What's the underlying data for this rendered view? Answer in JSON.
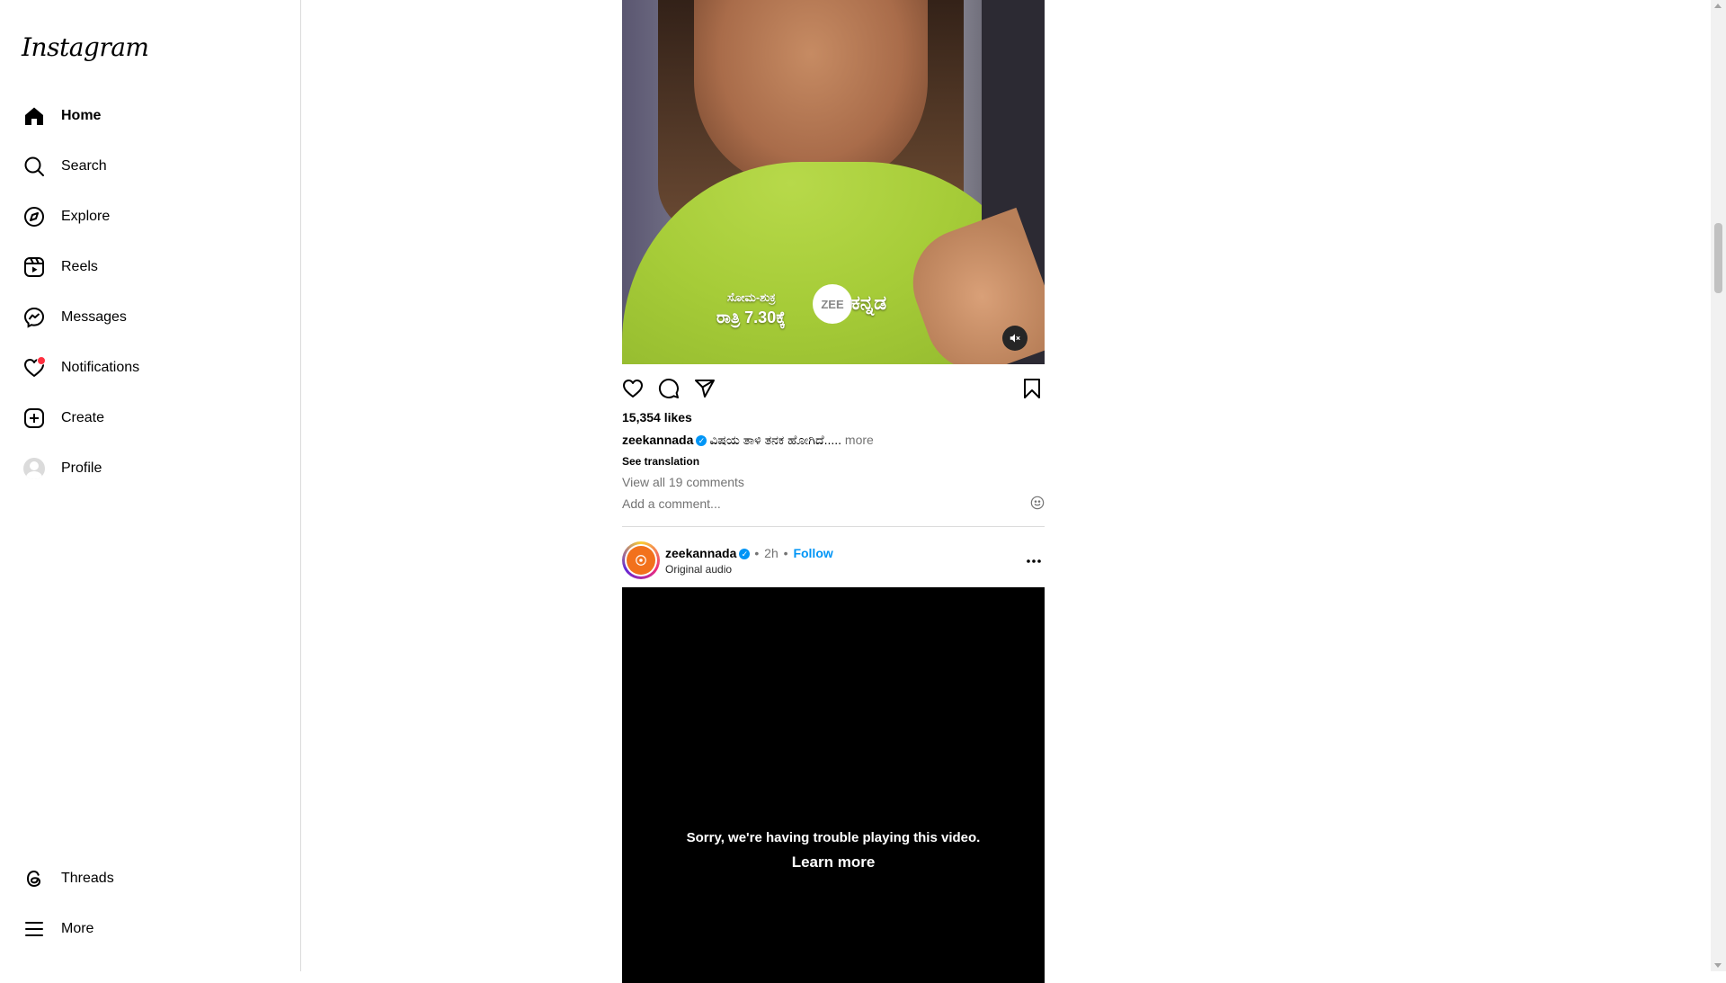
{
  "app": {
    "logo_text": "Instagram"
  },
  "sidebar": {
    "items": [
      {
        "label": "Home",
        "icon": "home-icon"
      },
      {
        "label": "Search",
        "icon": "search-icon"
      },
      {
        "label": "Explore",
        "icon": "compass-icon"
      },
      {
        "label": "Reels",
        "icon": "reels-icon"
      },
      {
        "label": "Messages",
        "icon": "messenger-icon"
      },
      {
        "label": "Notifications",
        "icon": "heart-icon"
      },
      {
        "label": "Create",
        "icon": "plus-square-icon"
      },
      {
        "label": "Profile",
        "icon": "avatar"
      }
    ],
    "bottom_items": [
      {
        "label": "Threads",
        "icon": "threads-icon"
      },
      {
        "label": "More",
        "icon": "menu-icon"
      }
    ],
    "active": "Home"
  },
  "post1": {
    "watermark_schedule": "ಸೋಮ-ಶುಕ್ರ",
    "watermark_time": "ರಾತ್ರಿ 7.30ಕ್ಕೆ",
    "watermark_logo": "ZEE",
    "watermark_channel": "ಕನ್ನಡ",
    "likes": "15,354 likes",
    "username": "zeekannada",
    "caption": "ವಿಷಯ ತಾಳಿ ತನಕ ಹೋಗಿದೆ.....",
    "more_label": "more",
    "see_translation": "See translation",
    "view_comments": "View all 19 comments",
    "comment_placeholder": "Add a comment..."
  },
  "post2": {
    "username": "zeekannada",
    "separator": "•",
    "time": "2h",
    "follow_label": "Follow",
    "audio": "Original audio",
    "video_error": "Sorry, we're having trouble playing this video.",
    "learn_more": "Learn more"
  },
  "colors": {
    "accent": "#0095f6",
    "notification_dot": "#ff3040",
    "muted_text": "#737373",
    "border": "#dbdbdb"
  }
}
